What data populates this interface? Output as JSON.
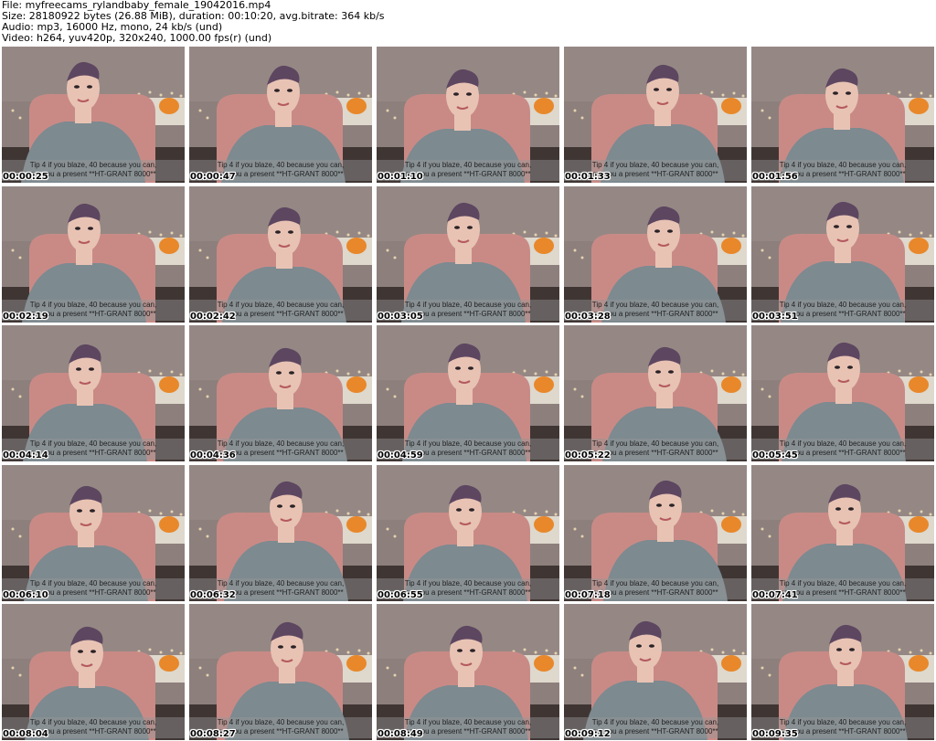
{
  "header": {
    "file_line": "File: myfreecams_rylandbaby_female_19042016.mp4",
    "size_line": "Size: 28180922 bytes (26.88 MiB), duration: 00:10:20, avg.bitrate: 364 kb/s",
    "audio_line": "Audio: mp3, 16000 Hz, mono, 24 kb/s (und)",
    "video_line": "Video: h264, yuv420p, 320x240, 1000.00 fps(r) (und)"
  },
  "caption": {
    "line1": "Tip 4 if you blaze, 40 because you can,",
    "line2": "get you a present **HT-GRANT 8000**"
  },
  "frames": [
    {
      "timestamp": "00:00:25"
    },
    {
      "timestamp": "00:00:47"
    },
    {
      "timestamp": "00:01:10"
    },
    {
      "timestamp": "00:01:33"
    },
    {
      "timestamp": "00:01:56"
    },
    {
      "timestamp": "00:02:19"
    },
    {
      "timestamp": "00:02:42"
    },
    {
      "timestamp": "00:03:05"
    },
    {
      "timestamp": "00:03:28"
    },
    {
      "timestamp": "00:03:51"
    },
    {
      "timestamp": "00:04:14"
    },
    {
      "timestamp": "00:04:36"
    },
    {
      "timestamp": "00:04:59"
    },
    {
      "timestamp": "00:05:22"
    },
    {
      "timestamp": "00:05:45"
    },
    {
      "timestamp": "00:06:10"
    },
    {
      "timestamp": "00:06:32"
    },
    {
      "timestamp": "00:06:55"
    },
    {
      "timestamp": "00:07:18"
    },
    {
      "timestamp": "00:07:41"
    },
    {
      "timestamp": "00:08:04"
    },
    {
      "timestamp": "00:08:27"
    },
    {
      "timestamp": "00:08:49"
    },
    {
      "timestamp": "00:09:12"
    },
    {
      "timestamp": "00:09:35"
    }
  ],
  "colors": {
    "wall": "#8d7f7c",
    "chair": "#c98a86",
    "shirt": "#7d8a90",
    "skin": "#e8c3b4",
    "hair": "#5d4660",
    "pillow": "#e8882a",
    "floor": "#3f3634"
  }
}
